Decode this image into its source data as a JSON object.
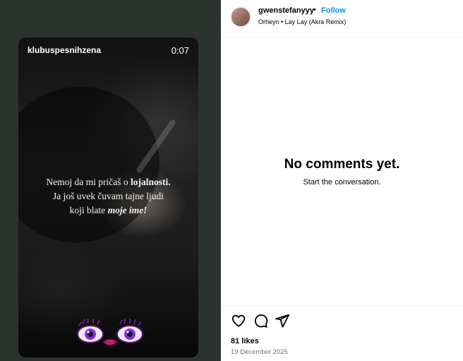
{
  "reel": {
    "username": "klubuspesnihzena",
    "time": "0:07",
    "caption": {
      "line1_a": "Nemoj da mi pričaš o ",
      "line1_b": "lojalnosti.",
      "line2": "Ja još uvek čuvam tajne ljudi",
      "line3_a": "koji blate ",
      "line3_b": "moje ime!"
    }
  },
  "post_header": {
    "username": "gwenstefanyyy",
    "separator": "•",
    "follow_label": "Follow",
    "audio": "Orheyn • Lay Lay (Akra Remix)"
  },
  "comments": {
    "empty_title": "No comments yet.",
    "empty_subtitle": "Start the conversation."
  },
  "actions": {
    "icons": [
      "heart-icon",
      "comment-icon",
      "share-icon"
    ]
  },
  "stats": {
    "likes": "81 likes",
    "date": "19 December 2025"
  },
  "colors": {
    "follow_blue": "#0095f6",
    "left_panel_bg": "#2b332f"
  }
}
